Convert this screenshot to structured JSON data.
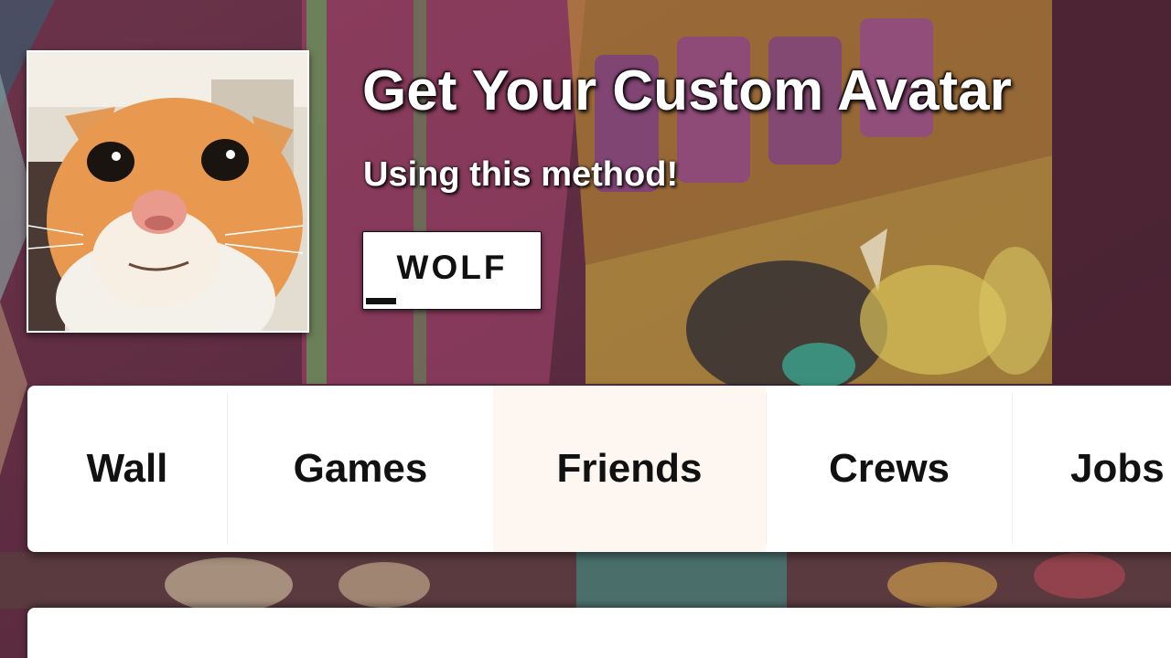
{
  "profile": {
    "headline": "Get Your Custom Avatar",
    "subheadline": "Using this method!",
    "username": "WOLF"
  },
  "tabs": [
    {
      "label": "Wall",
      "active": false
    },
    {
      "label": "Games",
      "active": false
    },
    {
      "label": "Friends",
      "active": true
    },
    {
      "label": "Crews",
      "active": false
    },
    {
      "label": "Jobs",
      "active": false
    }
  ],
  "colors": {
    "text_dark": "#111111",
    "active_tab_bg": "#fdf6f1",
    "panel_bg": "#ffffff",
    "headline": "#ffffff"
  },
  "icons": {
    "avatar": "orange-cat-photo",
    "background": "graffiti-wall"
  }
}
